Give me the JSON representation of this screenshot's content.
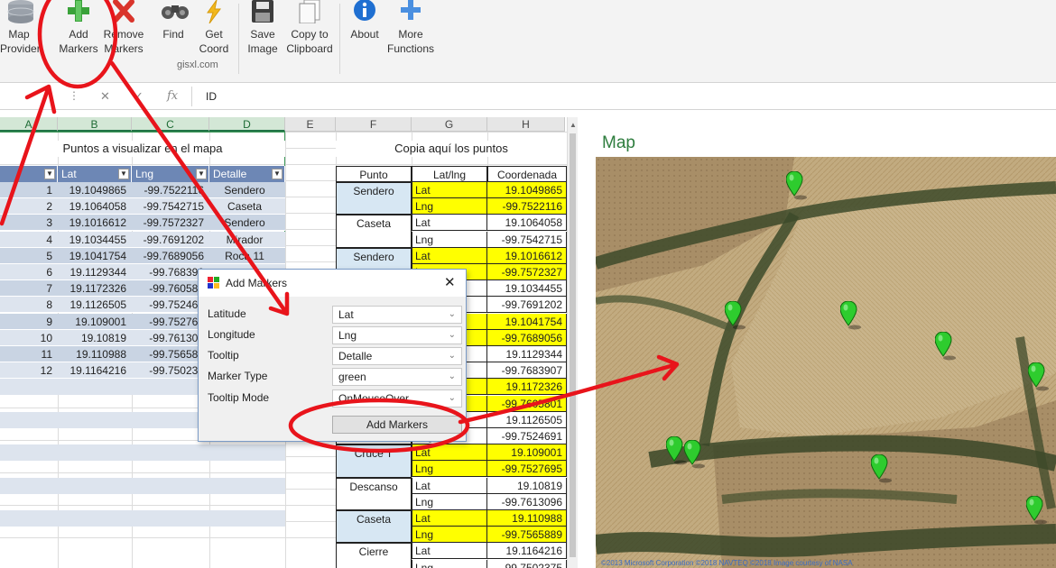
{
  "ribbon": {
    "buttons": [
      {
        "key": "map-provider",
        "line1": "Map",
        "line2": "Provider"
      },
      {
        "key": "add-markers",
        "line1": "Add",
        "line2": "Markers"
      },
      {
        "key": "remove-markers",
        "line1": "Remove",
        "line2": "Markers"
      },
      {
        "key": "find",
        "line1": "Find",
        "line2": ""
      },
      {
        "key": "get-coord",
        "line1": "Get",
        "line2": "Coord"
      },
      {
        "key": "save-image",
        "line1": "Save",
        "line2": "Image"
      },
      {
        "key": "copy-to-clipboard",
        "line1": "Copy to",
        "line2": "Clipboard"
      },
      {
        "key": "about",
        "line1": "About",
        "line2": ""
      },
      {
        "key": "more-functions",
        "line1": "More",
        "line2": "Functions"
      }
    ],
    "group_label": "gisxl.com"
  },
  "formula_bar": {
    "fx_label": "fx",
    "value": "ID"
  },
  "sheet": {
    "columns": [
      "A",
      "B",
      "C",
      "D",
      "E",
      "F",
      "G",
      "H"
    ],
    "left_title": "Puntos a visualizar en el mapa",
    "right_title": "Copia aquí los puntos",
    "left_headers": [
      "",
      "Lat",
      "Lng",
      "Detalle"
    ],
    "left_rows": [
      [
        "1",
        "19.1049865",
        "-99.7522116",
        "Sendero"
      ],
      [
        "2",
        "19.1064058",
        "-99.7542715",
        "Caseta"
      ],
      [
        "3",
        "19.1016612",
        "-99.7572327",
        "Sendero"
      ],
      [
        "4",
        "19.1034455",
        "-99.7691202",
        "Mirador"
      ],
      [
        "5",
        "19.1041754",
        "-99.7689056",
        "Roca 11"
      ],
      [
        "6",
        "19.1129344",
        "-99.768390",
        ""
      ],
      [
        "7",
        "19.1172326",
        "-99.760580",
        ""
      ],
      [
        "8",
        "19.1126505",
        "-99.752469",
        ""
      ],
      [
        "9",
        "19.109001",
        "-99.752769",
        ""
      ],
      [
        "10",
        "19.10819",
        "-99.761309",
        ""
      ],
      [
        "11",
        "19.110988",
        "-99.756588",
        ""
      ],
      [
        "12",
        "19.1164216",
        "-99.750237",
        ""
      ]
    ],
    "right_headers": [
      "Punto",
      "Lat/lng",
      "Coordenada"
    ],
    "right_rows": [
      {
        "punto": "Sendero",
        "a": [
          "Lat",
          "19.1049865"
        ],
        "b": [
          "Lng",
          "-99.7522116"
        ],
        "hl": true
      },
      {
        "punto": "Caseta",
        "a": [
          "Lat",
          "19.1064058"
        ],
        "b": [
          "Lng",
          "-99.7542715"
        ],
        "hl": false
      },
      {
        "punto": "Sendero",
        "a": [
          "Lat",
          "19.1016612"
        ],
        "b": [
          "Lng",
          "-99.7572327"
        ],
        "hl": true
      },
      {
        "punto": "",
        "a": [
          "Lat",
          "19.1034455"
        ],
        "b": [
          "Lng",
          "-99.7691202"
        ],
        "hl": false
      },
      {
        "punto": "",
        "a": [
          "Lat",
          "19.1041754"
        ],
        "b": [
          "Lng",
          "-99.7689056"
        ],
        "hl": true
      },
      {
        "punto": "",
        "a": [
          "Lat",
          "19.1129344"
        ],
        "b": [
          "Lng",
          "-99.7683907"
        ],
        "hl": false
      },
      {
        "punto": "",
        "a": [
          "Lat",
          "19.1172326"
        ],
        "b": [
          "Lng",
          "-99.7605801"
        ],
        "hl": true
      },
      {
        "punto": "",
        "a": [
          "Lat",
          "19.1126505"
        ],
        "b": [
          "Lng",
          "-99.7524691"
        ],
        "hl": false
      },
      {
        "punto": "Cruce T",
        "a": [
          "Lat",
          "19.109001"
        ],
        "b": [
          "Lng",
          "-99.7527695"
        ],
        "hl": true
      },
      {
        "punto": "Descanso",
        "a": [
          "Lat",
          "19.10819"
        ],
        "b": [
          "Lng",
          "-99.7613096"
        ],
        "hl": false
      },
      {
        "punto": "Caseta",
        "a": [
          "Lat",
          "19.110988"
        ],
        "b": [
          "Lng",
          "-99.7565889"
        ],
        "hl": true
      },
      {
        "punto": "Cierre",
        "a": [
          "Lat",
          "19.1164216"
        ],
        "b": [
          "Lng",
          "-99.7502375"
        ],
        "hl": false
      }
    ]
  },
  "dialog": {
    "title": "Add Markers",
    "fields": [
      {
        "label": "Latitude",
        "value": "Lat"
      },
      {
        "label": "Longitude",
        "value": "Lng"
      },
      {
        "label": "Tooltip",
        "value": "Detalle"
      },
      {
        "label": "Marker Type",
        "value": "green"
      },
      {
        "label": "Tooltip Mode",
        "value": "OnMouseOver"
      }
    ],
    "button_label": "Add Markers"
  },
  "map": {
    "title": "Map",
    "attribution": "©2013 Microsoft Corporation  ©2018 NAVTEQ  ©2018 Image courtesy of NASA"
  },
  "colors": {
    "accent_green": "#217346",
    "highlight_yellow": "#ffff00",
    "annotation_red": "#e8141b",
    "marker_green": "#2ecc2e",
    "table_band": "#c9d4e3",
    "dialog_border": "#7a9bc7"
  }
}
